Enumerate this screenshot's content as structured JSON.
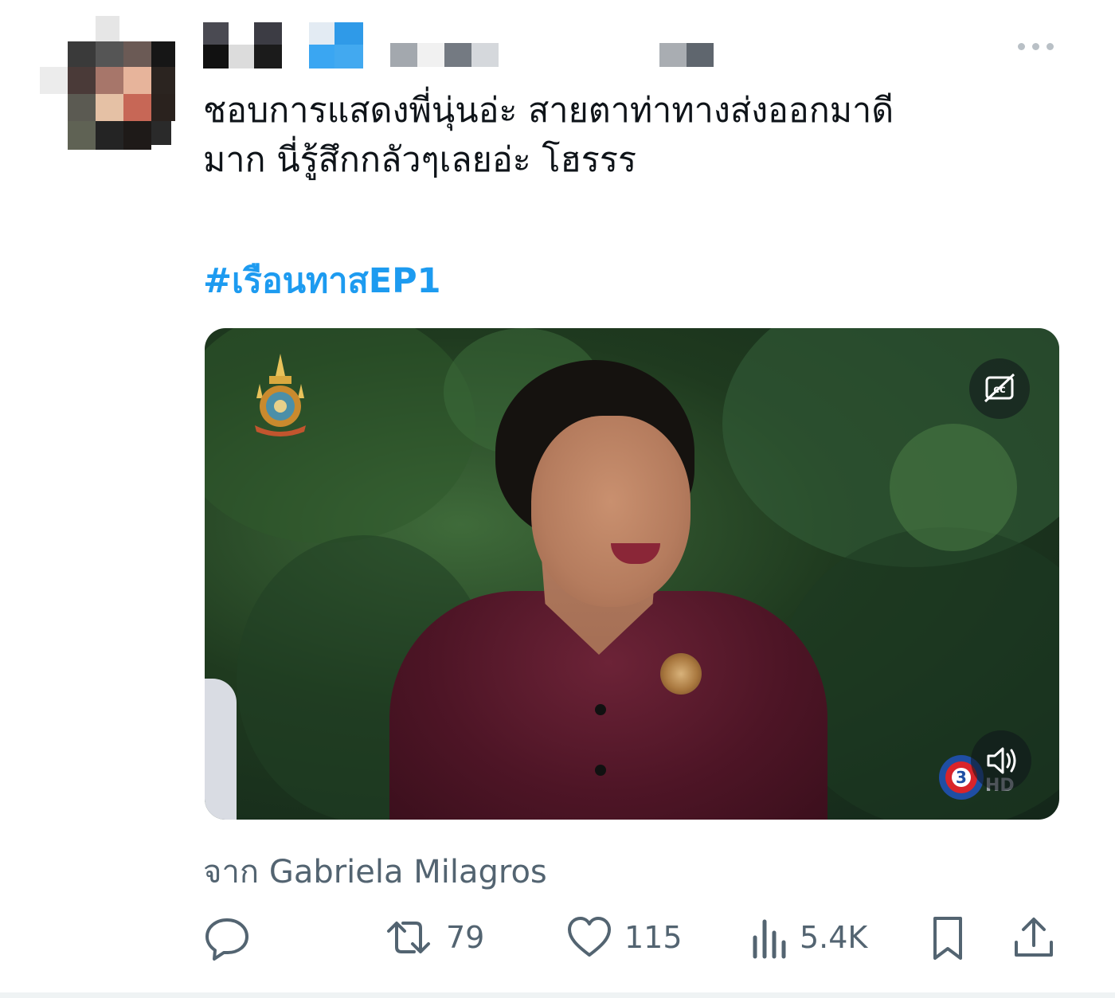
{
  "tweet": {
    "text": "ชอบการแสดงพี่นุ่นอ่ะ สายตาท่าทางส่งออกมาดี\nมาก นี่รู้สึกกลัวๆเลยอ่ะ โฮรรร",
    "hashtag": "#เรือนทาสEP1",
    "from_label": "จาก Gabriela Milagros",
    "video": {
      "channel_badge": "HD",
      "captions_icon": "closed-captions-icon",
      "volume_icon": "speaker-volume-icon"
    }
  },
  "actions": {
    "reply": {
      "icon": "reply-icon"
    },
    "retweet": {
      "icon": "retweet-icon",
      "count": "79"
    },
    "like": {
      "icon": "heart-icon",
      "count": "115"
    },
    "views": {
      "icon": "views-icon",
      "count": "5.4K"
    },
    "bookmark": {
      "icon": "bookmark-icon"
    },
    "share": {
      "icon": "share-icon"
    }
  },
  "colors": {
    "hashtag": "#1d9bf0",
    "muted": "#536471",
    "text": "#0f1419"
  }
}
